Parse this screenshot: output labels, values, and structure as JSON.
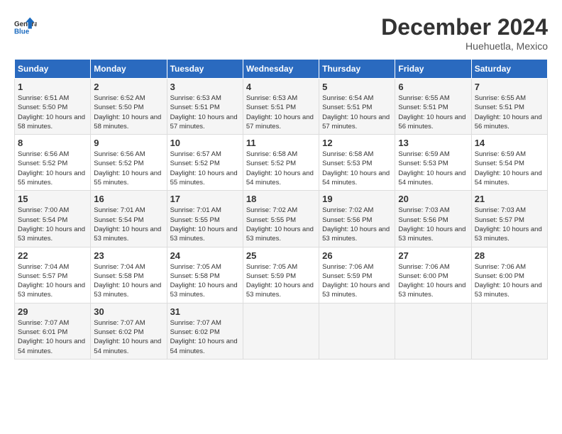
{
  "logo": {
    "line1": "General",
    "line2": "Blue"
  },
  "title": "December 2024",
  "subtitle": "Huehuetla, Mexico",
  "columns": [
    "Sunday",
    "Monday",
    "Tuesday",
    "Wednesday",
    "Thursday",
    "Friday",
    "Saturday"
  ],
  "weeks": [
    [
      {
        "day": "1",
        "sunrise": "6:51 AM",
        "sunset": "5:50 PM",
        "daylight": "10 hours and 58 minutes."
      },
      {
        "day": "2",
        "sunrise": "6:52 AM",
        "sunset": "5:50 PM",
        "daylight": "10 hours and 58 minutes."
      },
      {
        "day": "3",
        "sunrise": "6:53 AM",
        "sunset": "5:51 PM",
        "daylight": "10 hours and 57 minutes."
      },
      {
        "day": "4",
        "sunrise": "6:53 AM",
        "sunset": "5:51 PM",
        "daylight": "10 hours and 57 minutes."
      },
      {
        "day": "5",
        "sunrise": "6:54 AM",
        "sunset": "5:51 PM",
        "daylight": "10 hours and 57 minutes."
      },
      {
        "day": "6",
        "sunrise": "6:55 AM",
        "sunset": "5:51 PM",
        "daylight": "10 hours and 56 minutes."
      },
      {
        "day": "7",
        "sunrise": "6:55 AM",
        "sunset": "5:51 PM",
        "daylight": "10 hours and 56 minutes."
      }
    ],
    [
      {
        "day": "8",
        "sunrise": "6:56 AM",
        "sunset": "5:52 PM",
        "daylight": "10 hours and 55 minutes."
      },
      {
        "day": "9",
        "sunrise": "6:56 AM",
        "sunset": "5:52 PM",
        "daylight": "10 hours and 55 minutes."
      },
      {
        "day": "10",
        "sunrise": "6:57 AM",
        "sunset": "5:52 PM",
        "daylight": "10 hours and 55 minutes."
      },
      {
        "day": "11",
        "sunrise": "6:58 AM",
        "sunset": "5:52 PM",
        "daylight": "10 hours and 54 minutes."
      },
      {
        "day": "12",
        "sunrise": "6:58 AM",
        "sunset": "5:53 PM",
        "daylight": "10 hours and 54 minutes."
      },
      {
        "day": "13",
        "sunrise": "6:59 AM",
        "sunset": "5:53 PM",
        "daylight": "10 hours and 54 minutes."
      },
      {
        "day": "14",
        "sunrise": "6:59 AM",
        "sunset": "5:54 PM",
        "daylight": "10 hours and 54 minutes."
      }
    ],
    [
      {
        "day": "15",
        "sunrise": "7:00 AM",
        "sunset": "5:54 PM",
        "daylight": "10 hours and 53 minutes."
      },
      {
        "day": "16",
        "sunrise": "7:01 AM",
        "sunset": "5:54 PM",
        "daylight": "10 hours and 53 minutes."
      },
      {
        "day": "17",
        "sunrise": "7:01 AM",
        "sunset": "5:55 PM",
        "daylight": "10 hours and 53 minutes."
      },
      {
        "day": "18",
        "sunrise": "7:02 AM",
        "sunset": "5:55 PM",
        "daylight": "10 hours and 53 minutes."
      },
      {
        "day": "19",
        "sunrise": "7:02 AM",
        "sunset": "5:56 PM",
        "daylight": "10 hours and 53 minutes."
      },
      {
        "day": "20",
        "sunrise": "7:03 AM",
        "sunset": "5:56 PM",
        "daylight": "10 hours and 53 minutes."
      },
      {
        "day": "21",
        "sunrise": "7:03 AM",
        "sunset": "5:57 PM",
        "daylight": "10 hours and 53 minutes."
      }
    ],
    [
      {
        "day": "22",
        "sunrise": "7:04 AM",
        "sunset": "5:57 PM",
        "daylight": "10 hours and 53 minutes."
      },
      {
        "day": "23",
        "sunrise": "7:04 AM",
        "sunset": "5:58 PM",
        "daylight": "10 hours and 53 minutes."
      },
      {
        "day": "24",
        "sunrise": "7:05 AM",
        "sunset": "5:58 PM",
        "daylight": "10 hours and 53 minutes."
      },
      {
        "day": "25",
        "sunrise": "7:05 AM",
        "sunset": "5:59 PM",
        "daylight": "10 hours and 53 minutes."
      },
      {
        "day": "26",
        "sunrise": "7:06 AM",
        "sunset": "5:59 PM",
        "daylight": "10 hours and 53 minutes."
      },
      {
        "day": "27",
        "sunrise": "7:06 AM",
        "sunset": "6:00 PM",
        "daylight": "10 hours and 53 minutes."
      },
      {
        "day": "28",
        "sunrise": "7:06 AM",
        "sunset": "6:00 PM",
        "daylight": "10 hours and 53 minutes."
      }
    ],
    [
      {
        "day": "29",
        "sunrise": "7:07 AM",
        "sunset": "6:01 PM",
        "daylight": "10 hours and 54 minutes."
      },
      {
        "day": "30",
        "sunrise": "7:07 AM",
        "sunset": "6:02 PM",
        "daylight": "10 hours and 54 minutes."
      },
      {
        "day": "31",
        "sunrise": "7:07 AM",
        "sunset": "6:02 PM",
        "daylight": "10 hours and 54 minutes."
      },
      null,
      null,
      null,
      null
    ]
  ]
}
